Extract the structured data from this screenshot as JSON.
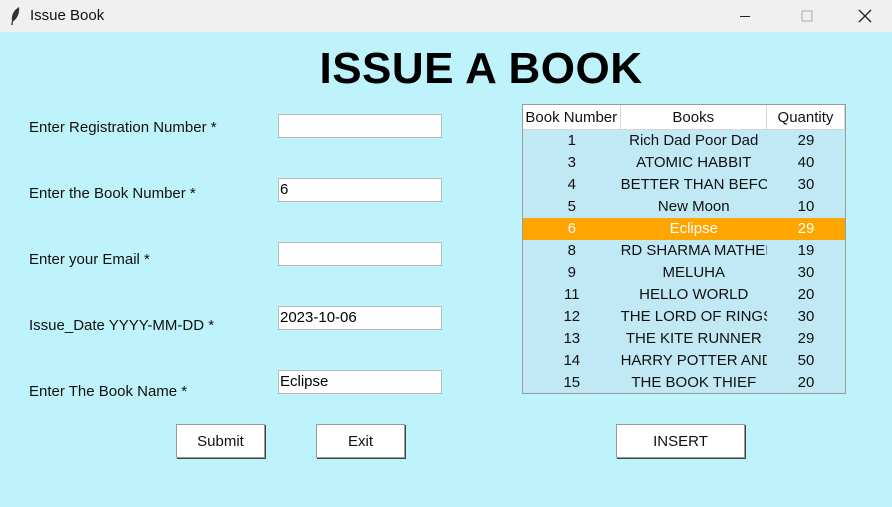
{
  "window": {
    "title": "Issue Book",
    "icon": "feather-icon"
  },
  "heading": "ISSUE A BOOK",
  "form": {
    "registration": {
      "label": "Enter Registration Number *",
      "value": ""
    },
    "book_number": {
      "label": "Enter the Book Number *",
      "value": "6"
    },
    "email": {
      "label": "Enter your Email *",
      "value": ""
    },
    "issue_date": {
      "label": "Issue_Date YYYY-MM-DD *",
      "value": "2023-10-06"
    },
    "book_name": {
      "label": "Enter The Book Name *",
      "value": "Eclipse"
    }
  },
  "buttons": {
    "submit": "Submit",
    "exit": "Exit",
    "insert": "INSERT"
  },
  "table": {
    "columns": [
      "Book Number",
      "Books",
      "Quantity"
    ],
    "selected_index": 4,
    "rows": [
      [
        "1",
        "Rich Dad Poor Dad",
        "29"
      ],
      [
        "3",
        "ATOMIC HABBIT",
        "40"
      ],
      [
        "4",
        "BETTER THAN BEFOR",
        "30"
      ],
      [
        "5",
        "New Moon",
        "10"
      ],
      [
        "6",
        "Eclipse",
        "29"
      ],
      [
        "8",
        "RD SHARMA MATHEI",
        "19"
      ],
      [
        "9",
        "MELUHA",
        "30"
      ],
      [
        "11",
        "HELLO WORLD",
        "20"
      ],
      [
        "12",
        "THE LORD OF RINGS",
        "30"
      ],
      [
        "13",
        "THE KITE RUNNER",
        "29"
      ],
      [
        "14",
        "HARRY POTTER AND",
        "50"
      ],
      [
        "15",
        "THE BOOK THIEF",
        "20"
      ]
    ]
  },
  "colors": {
    "background": "#bff3fb",
    "row_bg": "#c0e8f5",
    "selected_row": "#ffa500"
  }
}
